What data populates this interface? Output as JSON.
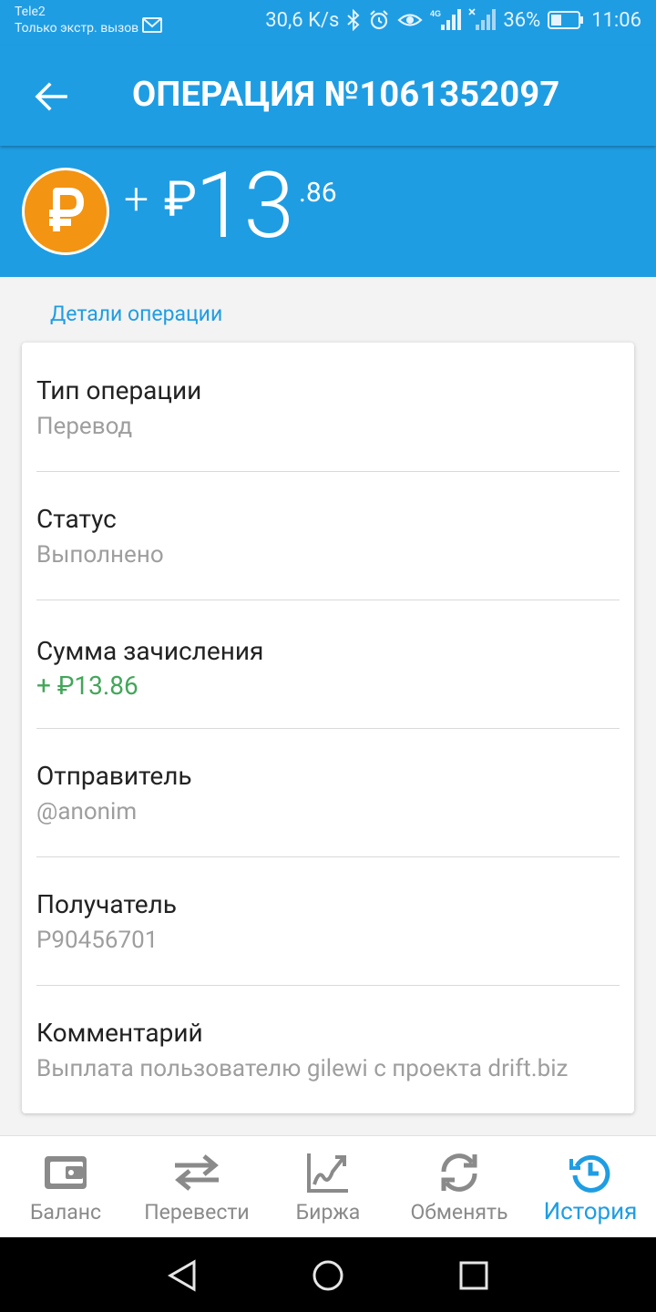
{
  "status_bar": {
    "carrier": "Tele2",
    "carrier_sub": "Только экстр. вызов",
    "speed": "30,6 K/s",
    "network": "4G",
    "battery": "36%",
    "time": "11:06"
  },
  "header": {
    "title": "ОПЕРАЦИЯ №1061352097"
  },
  "amount": {
    "sign": "+",
    "currency": "₽",
    "integer": "13",
    "decimal": ".86"
  },
  "details": {
    "section_title": "Детали операции",
    "rows": [
      {
        "label": "Тип операции",
        "value": "Перевод"
      },
      {
        "label": "Статус",
        "value": "Выполнено"
      },
      {
        "label": "Сумма зачисления",
        "value": "+ ₽13.86"
      },
      {
        "label": "Отправитель",
        "value": "@anonim"
      },
      {
        "label": "Получатель",
        "value": "P90456701"
      },
      {
        "label": "Комментарий",
        "value": "Выплата пользователю gilewi с проекта drift.biz"
      }
    ]
  },
  "bottom_nav": {
    "items": [
      {
        "label": "Баланс",
        "icon": "wallet-icon"
      },
      {
        "label": "Перевести",
        "icon": "transfer-icon"
      },
      {
        "label": "Биржа",
        "icon": "chart-icon"
      },
      {
        "label": "Обменять",
        "icon": "exchange-icon"
      },
      {
        "label": "История",
        "icon": "history-icon"
      }
    ],
    "active": "История"
  },
  "colors": {
    "primary": "#1f9de3",
    "coin": "#f39412",
    "positive": "#43a65a",
    "muted": "#9e9e9e"
  }
}
